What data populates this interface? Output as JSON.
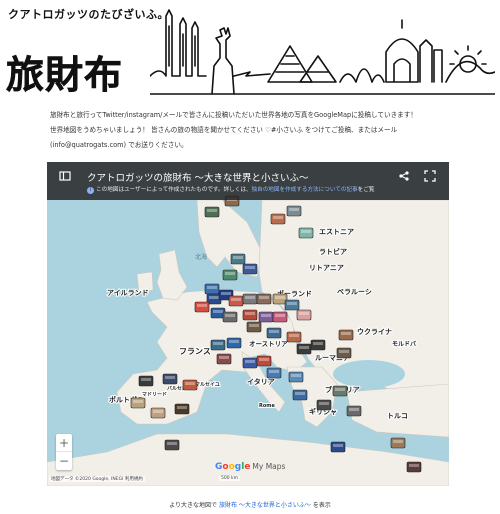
{
  "header": {
    "tagline": "クアトロガッツのたびざいふ。",
    "title": "旅財布"
  },
  "intro": {
    "line1": "旅財布と旅行ってTwitter/instagram/メールで皆さんに投稿いただいた世界各地の写真をGoogleMapに投稿していきます！",
    "line2": "世界地図をうめちゃいましょう！ 皆さんの旅の物語を聞かせてください ♡#小さいふ をつけてご投稿、またはメール",
    "line3": "(info@quatrogats.com) でお送りください。"
  },
  "map": {
    "title": "クアトロガッツの旅財布 〜大きな世界と小さいふ〜",
    "notice_prefix": "この地図はユーザーによって作成されたものです。詳しくは、",
    "notice_link": "独自の地図を作成する方法についての記事",
    "notice_suffix": "をご覧",
    "info_glyph": "i",
    "zoom_in": "+",
    "zoom_out": "−",
    "logo_g1": "G",
    "logo_g2": "o",
    "logo_g3": "o",
    "logo_g4": "g",
    "logo_g5": "l",
    "logo_g6": "e",
    "logo_maps": "My Maps",
    "attribution": "地図データ ©2020 Google, INEGI   利用規約",
    "scale": "500 km",
    "labels": {
      "estonia": "エストニア",
      "latvia": "ラトビア",
      "lithuania": "リトアニア",
      "north_sea": "北海",
      "belarus": "ベラルーシ",
      "ireland": "アイルランド",
      "poland": "ポーランド",
      "ukraine": "ウクライナ",
      "moldova": "モルドバ",
      "austria": "オーストリア",
      "france": "フランス",
      "romania": "ルーマニア",
      "bulgaria": "ブルガリア",
      "portugal": "ポルトガル",
      "italy": "イタリア",
      "greece": "ギリシャ",
      "turkey": "トルコ",
      "rome": "Rome",
      "marseille": "マルセイユ",
      "madrid": "マドリード",
      "barcelona": "バルセロナ"
    }
  },
  "footer": {
    "prefix": "より大きな地図で",
    "link": "旅財布 〜大きな世界と小さいふ〜",
    "suffix": "を表示"
  },
  "colors": {
    "sea": "#aad3df",
    "land": "#f2efe9",
    "topbar": "#2c2c2c",
    "link": "#1a5fd6"
  }
}
